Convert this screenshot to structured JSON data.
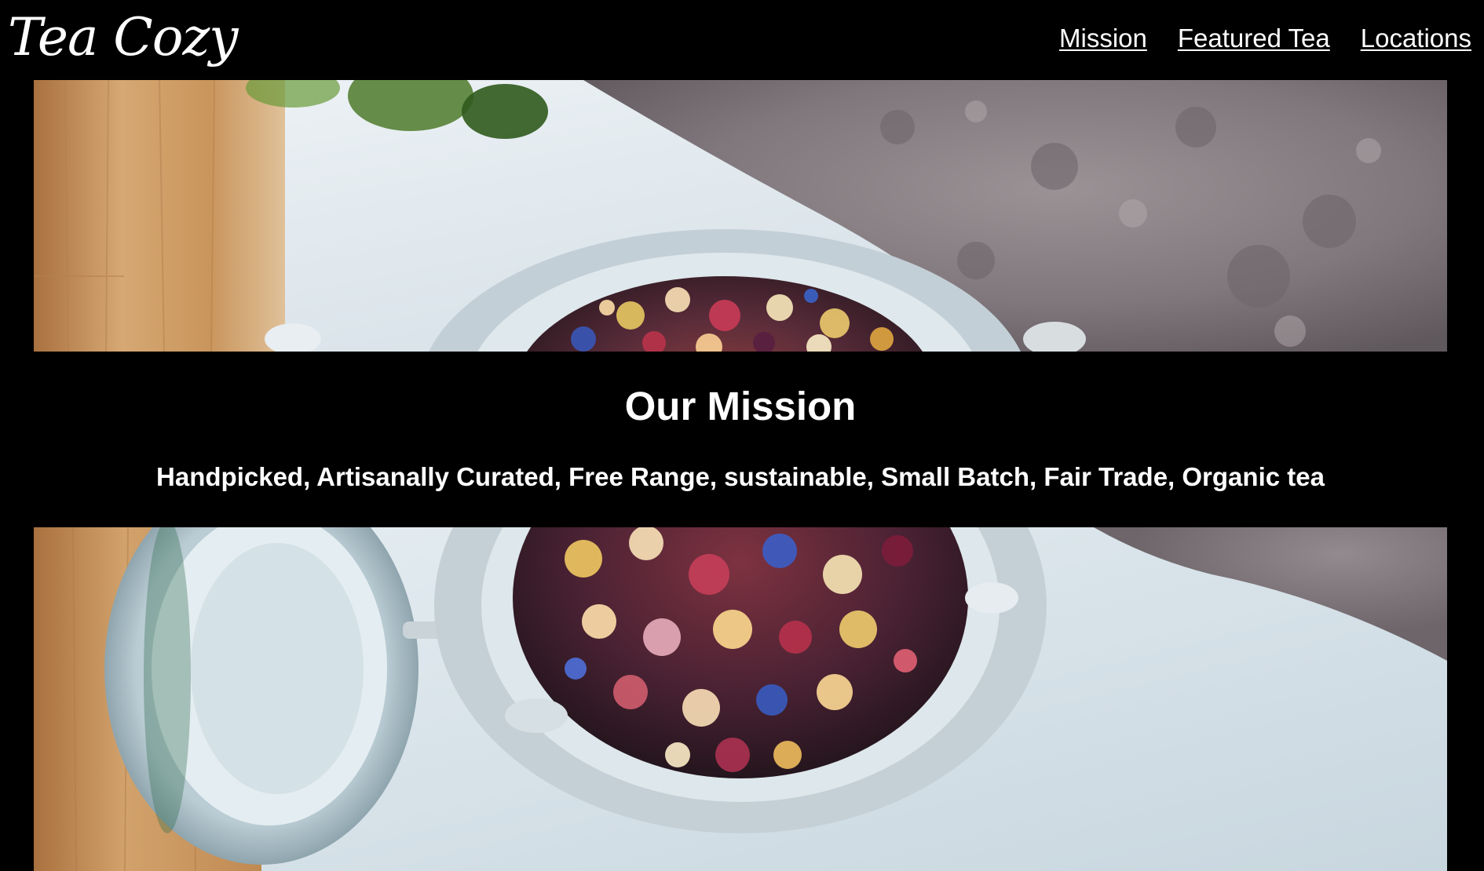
{
  "brand": {
    "logo_text": "Tea Cozy"
  },
  "nav": {
    "items": [
      "Mission",
      "Featured Tea",
      "Locations"
    ]
  },
  "hero_top": {
    "image": "tea-jar-photo"
  },
  "mission": {
    "title": "Our Mission",
    "text": "Handpicked, Artisanally Curated, Free Range, sustainable, Small Batch, Fair Trade, Organic tea"
  },
  "hero_bottom": {
    "image": "tea-jar-photo"
  },
  "colors": {
    "background": "#000000",
    "text": "#ffffff",
    "wood": "#c99a63",
    "table": "#dfe8ee",
    "cloth": "#8a8084"
  }
}
